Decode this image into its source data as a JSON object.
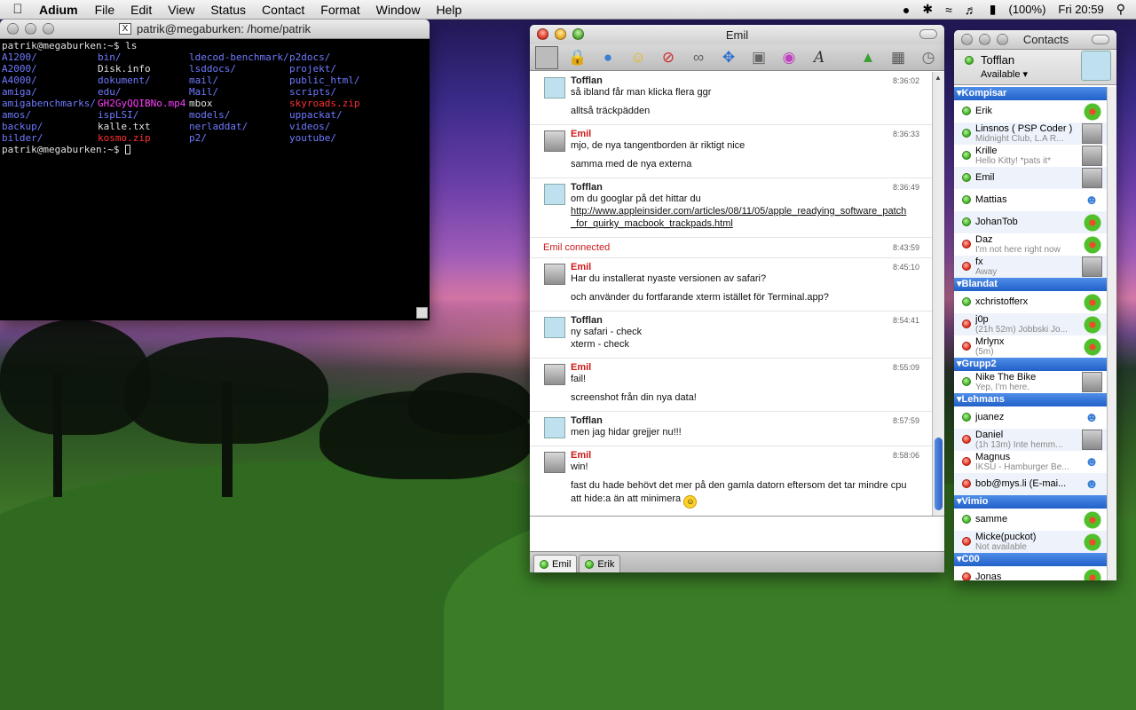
{
  "menubar": {
    "app_name": "Adium",
    "items": [
      "File",
      "Edit",
      "View",
      "Status",
      "Contact",
      "Format",
      "Window",
      "Help"
    ],
    "battery": "(100%)",
    "clock": "Fri 20:59"
  },
  "terminal": {
    "title": "patrik@megaburken: /home/patrik",
    "command_line": "patrik@megaburken:~$ ls",
    "prompt": "patrik@megaburken:~$ ",
    "listing": [
      {
        "text": "A1200/",
        "color": "blue"
      },
      {
        "text": "bin/",
        "color": "blue"
      },
      {
        "text": "ldecod-benchmark/",
        "color": "blue"
      },
      {
        "text": "p2docs/",
        "color": "blue"
      },
      {
        "text": "A2000/",
        "color": "blue"
      },
      {
        "text": "Disk.info",
        "color": "white"
      },
      {
        "text": "lsddocs/",
        "color": "blue"
      },
      {
        "text": "projekt/",
        "color": "blue"
      },
      {
        "text": "A4000/",
        "color": "blue"
      },
      {
        "text": "dokument/",
        "color": "blue"
      },
      {
        "text": "mail/",
        "color": "blue"
      },
      {
        "text": "public_html/",
        "color": "blue"
      },
      {
        "text": "amiga/",
        "color": "blue"
      },
      {
        "text": "edu/",
        "color": "blue"
      },
      {
        "text": "Mail/",
        "color": "blue"
      },
      {
        "text": "scripts/",
        "color": "blue"
      },
      {
        "text": "amigabenchmarks/",
        "color": "blue"
      },
      {
        "text": "GH2GyQQIBNo.mp4",
        "color": "magenta"
      },
      {
        "text": "mbox",
        "color": "white"
      },
      {
        "text": "skyroads.zip",
        "color": "red"
      },
      {
        "text": "amos/",
        "color": "blue"
      },
      {
        "text": "ispLSI/",
        "color": "blue"
      },
      {
        "text": "models/",
        "color": "blue"
      },
      {
        "text": "uppackat/",
        "color": "blue"
      },
      {
        "text": "backup/",
        "color": "blue"
      },
      {
        "text": "kalle.txt",
        "color": "white"
      },
      {
        "text": "nerladdat/",
        "color": "blue"
      },
      {
        "text": "videos/",
        "color": "blue"
      },
      {
        "text": "bilder/",
        "color": "blue"
      },
      {
        "text": "kosmo.zip",
        "color": "red"
      },
      {
        "text": "p2/",
        "color": "blue"
      },
      {
        "text": "youtube/",
        "color": "blue"
      }
    ]
  },
  "chat": {
    "title": "Emil",
    "status_event": {
      "text": "Emil connected",
      "time": "8:43:59"
    },
    "messages_before": [
      {
        "sender": "Tofflan",
        "kind": "tofflan",
        "time": "8:36:02",
        "blocks": [
          [
            "så ibland får man klicka flera ggr"
          ],
          [
            "alltså träckpädden"
          ]
        ]
      },
      {
        "sender": "Emil",
        "kind": "emil",
        "time": "8:36:33",
        "blocks": [
          [
            "mjo, de nya tangentborden är riktigt nice"
          ],
          [
            "samma med de nya externa"
          ]
        ]
      },
      {
        "sender": "Tofflan",
        "kind": "tofflan",
        "time": "8:36:49",
        "blocks": [
          [
            "om du googlar på det hittar du"
          ]
        ],
        "link": [
          "http://www.appleinsider.com/articles/08/11/05/apple_readying_software_patch",
          "_for_quirky_macbook_trackpads.html"
        ]
      }
    ],
    "messages_after": [
      {
        "sender": "Emil",
        "kind": "emil",
        "time": "8:45:10",
        "blocks": [
          [
            "Har du installerat nyaste versionen av safari?"
          ],
          [
            "och använder du fortfarande xterm istället för Terminal.app?"
          ]
        ]
      },
      {
        "sender": "Tofflan",
        "kind": "tofflan",
        "time": "8:54:41",
        "blocks": [
          [
            "ny safari - check",
            "xterm - check"
          ]
        ]
      },
      {
        "sender": "Emil",
        "kind": "emil",
        "time": "8:55:09",
        "blocks": [
          [
            "fail!"
          ],
          [
            "screenshot från din nya data!"
          ]
        ]
      },
      {
        "sender": "Tofflan",
        "kind": "tofflan",
        "time": "8:57:59",
        "blocks": [
          [
            "men jag hidar grejjer nu!!!"
          ]
        ]
      },
      {
        "sender": "Emil",
        "kind": "emil",
        "time": "8:58:06",
        "blocks": [
          [
            "win!"
          ],
          [
            "fast du hade behövt det mer på den gamla datorn eftersom det tar mindre cpu",
            "att hide:a än att minimera"
          ]
        ],
        "smiley": true
      }
    ],
    "tabs": [
      {
        "label": "Emil",
        "active": true
      },
      {
        "label": "Erik",
        "active": false
      }
    ]
  },
  "contacts": {
    "title": "Contacts",
    "self_name": "Tofflan",
    "self_status": "Available ▾",
    "groups": [
      {
        "name": "Kompisar",
        "contacts": [
          {
            "name": "Erik",
            "status": "online",
            "icon": "icq"
          },
          {
            "name": "Linsnos ( PSP Coder )",
            "sub": "Midnight Club, L.A R...",
            "status": "online",
            "icon": "photo"
          },
          {
            "name": "Krille",
            "sub": "Hello Kitty! *pats it*",
            "status": "online",
            "icon": "photo"
          },
          {
            "name": "Emil",
            "status": "online",
            "icon": "photo"
          },
          {
            "name": "Mattias",
            "status": "online",
            "icon": "msn"
          },
          {
            "name": "JohanTob",
            "status": "online",
            "icon": "icq"
          },
          {
            "name": "Daz",
            "sub": "I'm not here right now",
            "status": "away",
            "icon": "icq"
          },
          {
            "name": "fx",
            "sub": "Away",
            "status": "away",
            "icon": "photo"
          }
        ]
      },
      {
        "name": "Blandat",
        "contacts": [
          {
            "name": "xchristofferx",
            "status": "online",
            "icon": "icq"
          },
          {
            "name": "j0p",
            "sub": "(21h 52m) Jobbski Jo...",
            "status": "away",
            "icon": "icq"
          },
          {
            "name": "Mrlynx",
            "sub": "(5m)",
            "status": "away",
            "icon": "icq"
          }
        ]
      },
      {
        "name": "Grupp2",
        "contacts": [
          {
            "name": "Nike The Bike",
            "sub": "Yep, I'm here.",
            "status": "online",
            "icon": "photo"
          }
        ]
      },
      {
        "name": "Lehmans",
        "contacts": [
          {
            "name": "juanez",
            "status": "online",
            "icon": "msn"
          },
          {
            "name": "Daniel",
            "sub": "(1h 13m) Inte hemm...",
            "status": "away",
            "icon": "photo"
          },
          {
            "name": "Magnus",
            "sub": "IKSU - Hamburger Be...",
            "status": "away",
            "icon": "msn"
          },
          {
            "name": "bob@mys.li (E-mai...",
            "status": "away",
            "icon": "msn"
          }
        ]
      },
      {
        "name": "Vimio",
        "contacts": [
          {
            "name": "samme",
            "status": "online",
            "icon": "icq"
          },
          {
            "name": "Micke(puckot)",
            "sub": "Not available",
            "status": "away",
            "icon": "icq"
          }
        ]
      },
      {
        "name": "C00",
        "contacts": [
          {
            "name": "Jonas",
            "status": "away",
            "icon": "icq"
          }
        ]
      }
    ]
  }
}
